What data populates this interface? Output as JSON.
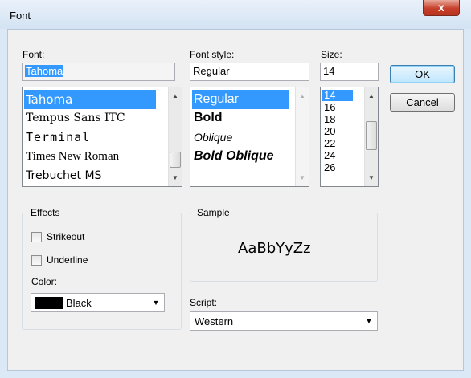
{
  "window": {
    "title": "Font",
    "close_label": "x"
  },
  "font": {
    "label": "Font:",
    "value": "Tahoma",
    "items": [
      "Tahoma",
      "Tempus Sans ITC",
      "Terminal",
      "Times New Roman",
      "Trebuchet MS"
    ]
  },
  "style": {
    "label": "Font style:",
    "value": "Regular",
    "items": [
      "Regular",
      "Bold",
      "Oblique",
      "Bold Oblique"
    ]
  },
  "size": {
    "label": "Size:",
    "value": "14",
    "items": [
      "14",
      "16",
      "18",
      "20",
      "22",
      "24",
      "26"
    ]
  },
  "buttons": {
    "ok": "OK",
    "cancel": "Cancel"
  },
  "effects": {
    "title": "Effects",
    "strikeout": "Strikeout",
    "strikeout_checked": false,
    "underline": "Underline",
    "underline_checked": false,
    "color_label": "Color:",
    "color_value": "Black",
    "color_swatch": "#000000"
  },
  "sample": {
    "title": "Sample",
    "text": "AaBbYyZz"
  },
  "script": {
    "label": "Script:",
    "value": "Western"
  },
  "colors": {
    "selection": "#3399ff",
    "close": "#c7402c"
  }
}
